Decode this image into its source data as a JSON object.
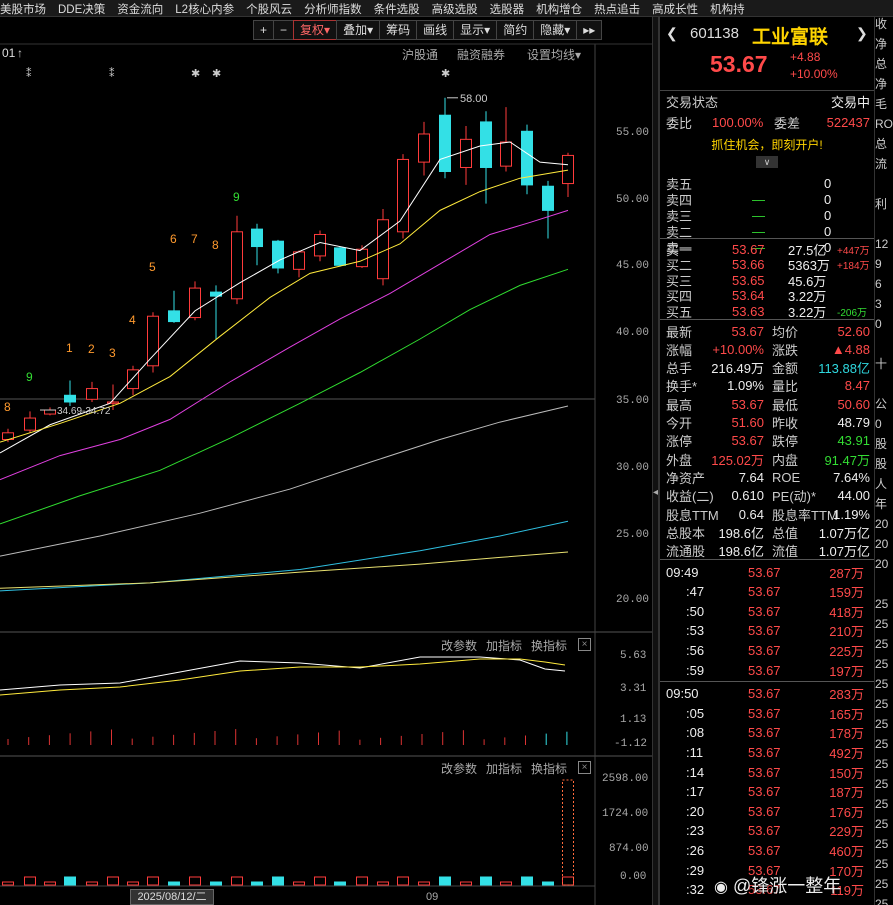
{
  "topnav": [
    "美股市场",
    "DDE决策",
    "资金流向",
    "L2核心内参",
    "个股风云",
    "分析师指数",
    "条件选股",
    "高级选股",
    "选股器",
    "机构增仓",
    "热点追击",
    "高成长性",
    "机构持"
  ],
  "toolbar": {
    "plus": "+",
    "minus": "−",
    "fuquan": "复权",
    "fuquan_arrow": "▾",
    "diejia": "叠加",
    "diejia_arrow": "▾",
    "chouma": "筹码",
    "huaxian": "画线",
    "xianshi": "显示",
    "xianshi_arrow": "▾",
    "jianyue": "简约",
    "yincang": "隐藏",
    "yincang_arrow": "▾",
    "expand": "▸▸"
  },
  "chart_links": {
    "hgt": "沪股通",
    "rzrq": "融资融券",
    "ma_set": "设置均线",
    "ma_set_arrow": "▾",
    "date_hint": "01"
  },
  "price_axis": [
    "55.00",
    "50.00",
    "45.00",
    "40.00",
    "35.00",
    "30.00",
    "25.00",
    "20.00"
  ],
  "price_notes": {
    "high_label": "58.00",
    "low_label": "34.69-34.72"
  },
  "td_counts": [
    "8",
    "9",
    "1",
    "2",
    "3",
    "4",
    "5",
    "6",
    "7",
    "8",
    "9"
  ],
  "macd_panel": {
    "change": "改参数",
    "add": "加指标",
    "switch": "换指标",
    "close": "×",
    "axis": [
      "5.63",
      "3.31",
      "1.13",
      "-1.12"
    ]
  },
  "vol_panel": {
    "change": "改参数",
    "add": "加指标",
    "switch": "换指标",
    "close": "×",
    "axis": [
      "2598.00",
      "1724.00",
      "874.00",
      "0.00"
    ]
  },
  "xaxis": {
    "date": "2025/08/12/二",
    "month": "09"
  },
  "stock": {
    "code": "601138",
    "name": "工业富联",
    "price": "53.67",
    "change": "+4.88",
    "pct": "+10.00%"
  },
  "status": {
    "label": "交易状态",
    "value": "交易中",
    "webi_l": "委比",
    "webi": "100.00%",
    "weicha_l": "委差",
    "weicha": "522437",
    "promo": "抓住机会，即刻开户!"
  },
  "sells": [
    {
      "l": "卖五",
      "p": "",
      "v": "0"
    },
    {
      "l": "卖四",
      "p": "—",
      "v": "0"
    },
    {
      "l": "卖三",
      "p": "—",
      "v": "0"
    },
    {
      "l": "卖二",
      "p": "—",
      "v": "0"
    },
    {
      "l": "卖一",
      "p": "—",
      "v": "0"
    }
  ],
  "buys": [
    {
      "l": "买一",
      "p": "53.67",
      "v": "27.5亿",
      "d": "+447万"
    },
    {
      "l": "买二",
      "p": "53.66",
      "v": "5363万",
      "d": "+184万"
    },
    {
      "l": "买三",
      "p": "53.65",
      "v": "45.6万",
      "d": ""
    },
    {
      "l": "买四",
      "p": "53.64",
      "v": "3.22万",
      "d": ""
    },
    {
      "l": "买五",
      "p": "53.63",
      "v": "3.22万",
      "d": "-206万"
    }
  ],
  "stats": [
    {
      "l1": "最新",
      "v1": "53.67",
      "c1": "red",
      "l2": "均价",
      "v2": "52.60",
      "c2": "red"
    },
    {
      "l1": "涨幅",
      "v1": "+10.00%",
      "c1": "red",
      "l2": "涨跌",
      "v2": "▲4.88",
      "c2": "red"
    },
    {
      "l1": "总手",
      "v1": "216.49万",
      "c1": "white",
      "l2": "金额",
      "v2": "113.88亿",
      "c2": "cyan"
    },
    {
      "l1": "换手*",
      "v1": "1.09%",
      "c1": "white",
      "l2": "量比",
      "v2": "8.47",
      "c2": "red"
    },
    {
      "l1": "最高",
      "v1": "53.67",
      "c1": "red",
      "l2": "最低",
      "v2": "50.60",
      "c2": "red"
    },
    {
      "l1": "今开",
      "v1": "51.60",
      "c1": "red",
      "l2": "昨收",
      "v2": "48.79",
      "c2": "white"
    },
    {
      "l1": "涨停",
      "v1": "53.67",
      "c1": "red",
      "l2": "跌停",
      "v2": "43.91",
      "c2": "green"
    },
    {
      "l1": "外盘",
      "v1": "125.02万",
      "c1": "red",
      "l2": "内盘",
      "v2": "91.47万",
      "c2": "green"
    },
    {
      "l1": "净资产",
      "v1": "7.64",
      "c1": "white",
      "l2": "ROE",
      "v2": "7.64%",
      "c2": "white"
    },
    {
      "l1": "收益(二)",
      "v1": "0.610",
      "c1": "white",
      "l2": "PE(动)*",
      "v2": "44.00",
      "c2": "white"
    },
    {
      "l1": "股息TTM",
      "v1": "0.64",
      "c1": "white",
      "l2": "股息率TTM",
      "v2": "1.19%",
      "c2": "white"
    },
    {
      "l1": "总股本",
      "v1": "198.6亿",
      "c1": "white",
      "l2": "总值",
      "v2": "1.07万亿",
      "c2": "white"
    },
    {
      "l1": "流通股",
      "v1": "198.6亿",
      "c1": "white",
      "l2": "流值",
      "v2": "1.07万亿",
      "c2": "white"
    }
  ],
  "ticks": [
    {
      "t": "09:49",
      "p": "53.67",
      "v": "287万"
    },
    {
      "t": ":47",
      "p": "53.67",
      "v": "159万"
    },
    {
      "t": ":50",
      "p": "53.67",
      "v": "418万"
    },
    {
      "t": ":53",
      "p": "53.67",
      "v": "210万"
    },
    {
      "t": ":56",
      "p": "53.67",
      "v": "225万"
    },
    {
      "t": ":59",
      "p": "53.67",
      "v": "197万"
    },
    {
      "t": "09:50",
      "p": "53.67",
      "v": "283万"
    },
    {
      "t": ":05",
      "p": "53.67",
      "v": "165万"
    },
    {
      "t": ":08",
      "p": "53.67",
      "v": "178万"
    },
    {
      "t": ":11",
      "p": "53.67",
      "v": "492万"
    },
    {
      "t": ":14",
      "p": "53.67",
      "v": "150万"
    },
    {
      "t": ":17",
      "p": "53.67",
      "v": "187万"
    },
    {
      "t": ":20",
      "p": "53.67",
      "v": "176万"
    },
    {
      "t": ":23",
      "p": "53.67",
      "v": "229万"
    },
    {
      "t": ":26",
      "p": "53.67",
      "v": "460万"
    },
    {
      "t": ":29",
      "p": "53.67",
      "v": "170万"
    },
    {
      "t": ":32",
      "p": "53.67",
      "v": "119万"
    }
  ],
  "edge_col": [
    "收",
    "净",
    "总",
    "净",
    "毛",
    "RO",
    "总",
    "流",
    "",
    "利",
    "",
    "12",
    "9",
    "6",
    "3",
    "0",
    "",
    "十",
    "",
    "公",
    "0",
    "股",
    "股",
    "人",
    "年",
    "20",
    "20",
    "20",
    "",
    "25",
    "25",
    "25",
    "25",
    "25",
    "25",
    "25",
    "25",
    "25",
    "25",
    "25",
    "25",
    "25",
    "25",
    "25",
    "25"
  ],
  "watermark": "@锋涨一整年"
}
